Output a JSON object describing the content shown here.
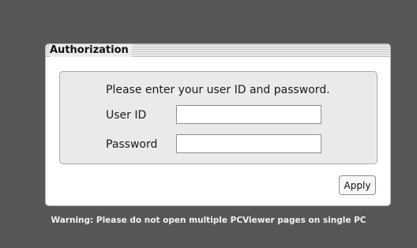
{
  "dialog": {
    "title": "Authorization",
    "prompt": "Please enter your user ID and password.",
    "user_id_label": "User ID",
    "user_id_value": "",
    "password_label": "Password",
    "password_value": "",
    "apply_label": "Apply"
  },
  "warning": "Warning: Please do not open multiple PCViewer pages on single PC",
  "colors": {
    "page_background": "#575757",
    "panel_background": "#ffffff",
    "inner_background": "#eaeaea",
    "warning_text": "#f2f2f2"
  }
}
